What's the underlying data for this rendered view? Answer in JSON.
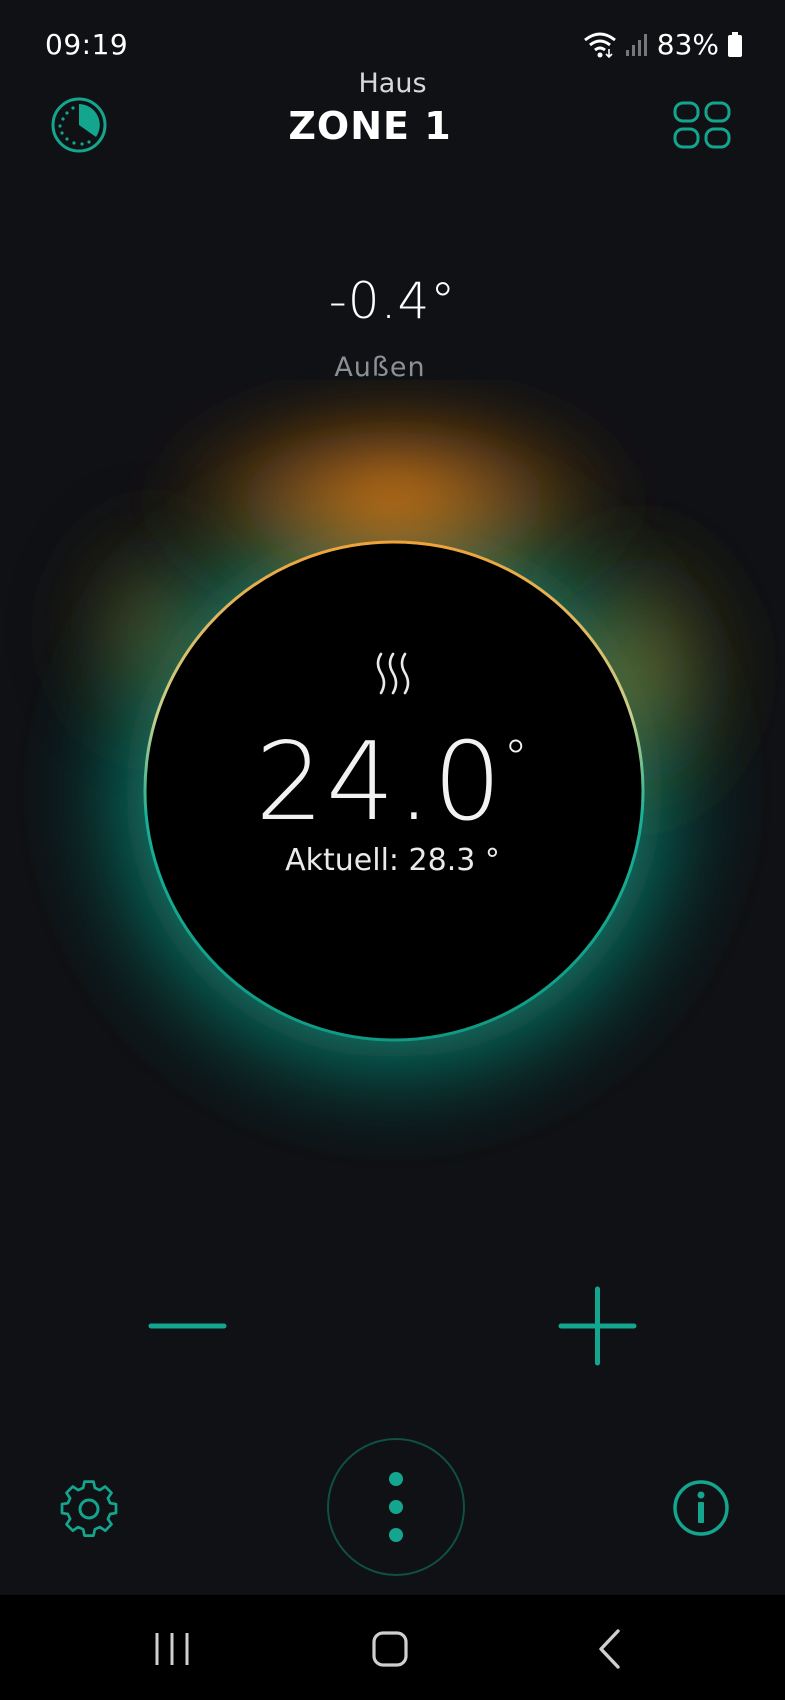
{
  "status": {
    "time": "09:19",
    "battery": "83%",
    "icons": [
      "wifi-icon",
      "signal-icon",
      "battery-icon"
    ]
  },
  "header": {
    "subtitle": "Haus",
    "title": "ZONE 1",
    "left_icon": "history-clock-icon",
    "right_icon": "grid-icon"
  },
  "outside": {
    "temperature": "-0.4°",
    "label": "Außen"
  },
  "dial": {
    "mode_icon": "heat-waves-icon",
    "setpoint": "24.0",
    "setpoint_unit": "°",
    "current": "Aktuell: 28.3 °"
  },
  "controls": {
    "decrease_icon": "minus-icon",
    "increase_icon": "plus-icon",
    "settings_icon": "gear-icon",
    "menu_icon": "vertical-dots-icon",
    "info_icon": "info-icon"
  },
  "nav": {
    "icons": [
      "recent-apps-icon",
      "home-icon",
      "back-icon"
    ]
  },
  "colors": {
    "background": "#0f1115",
    "accent": "#14a58e",
    "heat_orange": "#e07a10",
    "dial_face": "#000000",
    "muted_text": "#8c8f94"
  }
}
